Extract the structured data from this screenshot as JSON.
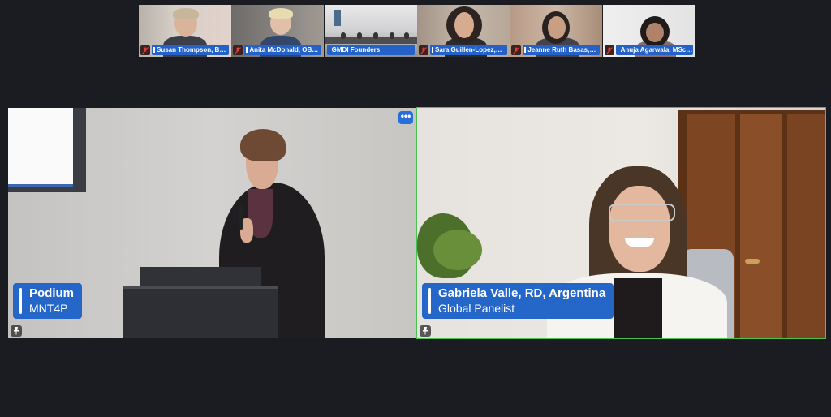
{
  "participants": [
    {
      "name": "Susan Thompson, BS…",
      "muted": true
    },
    {
      "name": "Anita McDonald, OB…",
      "muted": true
    },
    {
      "name": "GMDI Founders",
      "muted": false
    },
    {
      "name": "Sara Guillen-Lopez,…",
      "muted": true
    },
    {
      "name": "Jeanne Ruth Basas,…",
      "muted": true
    },
    {
      "name": "Anuja Agarwala, MSc…",
      "muted": true
    }
  ],
  "main_left": {
    "name": "Podium",
    "subtitle": "MNT4P",
    "more_label": "•••"
  },
  "main_right": {
    "name": "Gabriela Valle, RD, Argentina",
    "subtitle": "Global Panelist"
  },
  "colors": {
    "accent": "#2566c9",
    "active_speaker": "#49c04f",
    "background": "#1b1c21"
  }
}
